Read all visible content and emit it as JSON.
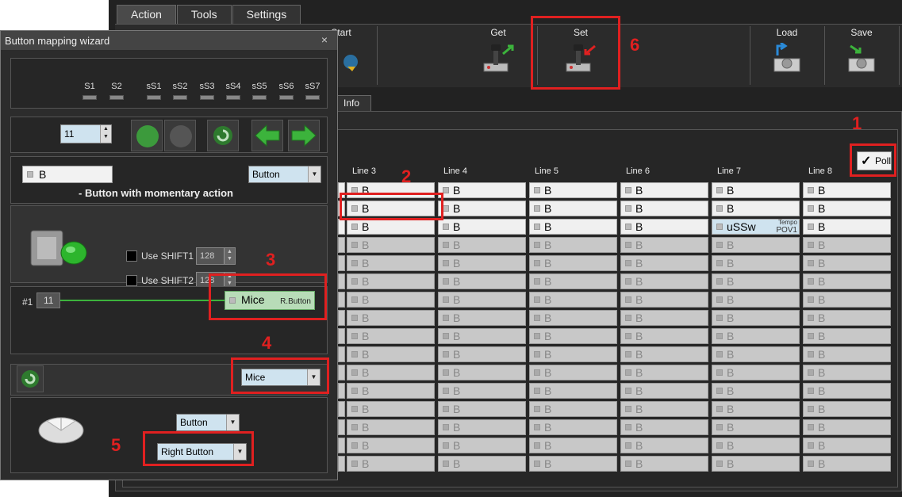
{
  "main": {
    "tabs": [
      {
        "label": "Action"
      },
      {
        "label": "Tools"
      },
      {
        "label": "Settings"
      }
    ],
    "toolbar": {
      "start_label": "Start",
      "get_label": "Get",
      "set_label": "Set",
      "load_label": "Load",
      "save_label": "Save"
    },
    "subtab_info": "Info",
    "poll_label": "Poll",
    "lines": [
      "Line 3",
      "Line 4",
      "Line 5",
      "Line 6",
      "Line 7",
      "Line 8"
    ],
    "cell_text": "B",
    "special_cell": {
      "text": "uSSw",
      "sub1": "Tempo",
      "sub2": "POV1"
    }
  },
  "dialog": {
    "title": "Button mapping wizard",
    "close": "×",
    "shifts": [
      "S1",
      "S2",
      "sS1",
      "sS2",
      "sS3",
      "sS4",
      "sS5",
      "sS6",
      "sS7"
    ],
    "button_number": "11",
    "button_field": "B",
    "type_combo": "Button",
    "description": "- Button with momentary action",
    "use_shift1": "Use SHIFT1",
    "use_shift2": "Use SHIFT2",
    "shift1_value": "128",
    "shift2_value": "128",
    "mapping_index": "#1",
    "mapping_number": "11",
    "mapping_target": "Mice",
    "mapping_target_sub": "R.Button",
    "device_combo": "Mice",
    "mouse_type_combo": "Button",
    "mouse_button_combo": "Right Button"
  },
  "annotations": [
    "1",
    "2",
    "3",
    "4",
    "5",
    "6"
  ],
  "colors": {
    "annotation": "#e02020",
    "field_blue": "#cfe3ef",
    "accent_green": "#3cb33c"
  }
}
